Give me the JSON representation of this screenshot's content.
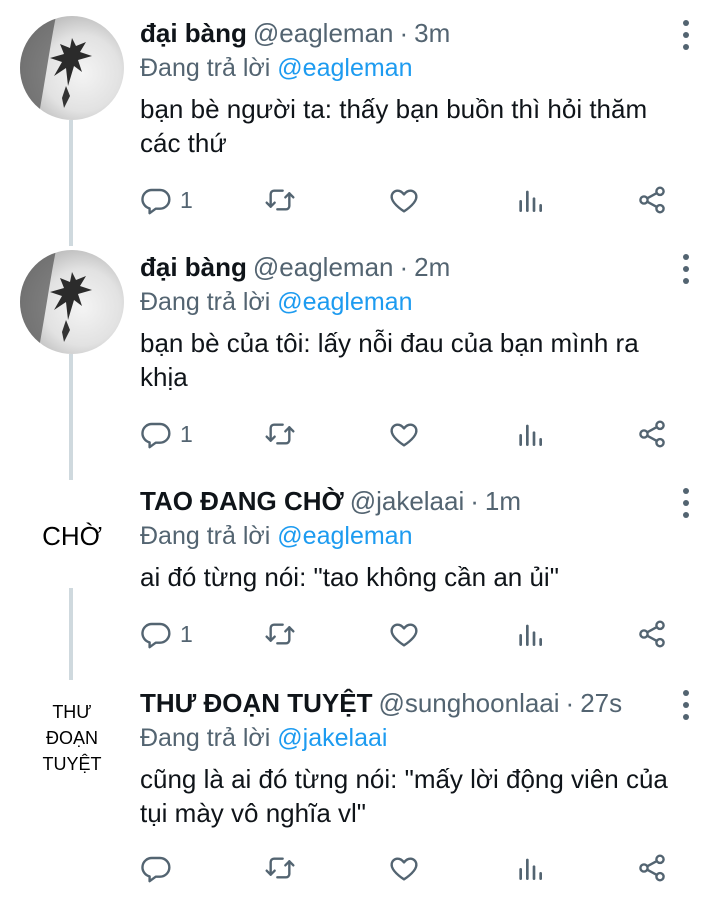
{
  "replying_to_label": "Đang trả lời",
  "tweets": [
    {
      "name": "đại bàng",
      "handle": "@eagleman",
      "time": "3m",
      "reply_to": "@eagleman",
      "text": "bạn bè người ta: thấy bạn buồn thì hỏi thăm các thứ",
      "reply_count": "1",
      "avatar_icon": "eagle-photo-avatar"
    },
    {
      "name": "đại bàng",
      "handle": "@eagleman",
      "time": "2m",
      "reply_to": "@eagleman",
      "text": "bạn bè của tôi: lấy nỗi đau của bạn mình ra khịa",
      "reply_count": "1",
      "avatar_icon": "eagle-photo-avatar"
    },
    {
      "name": "TAO ĐANG CHỜ",
      "handle": "@jakelaai",
      "time": "1m",
      "reply_to": "@eagleman",
      "text": "ai đó từng nói: \"tao không cần an ủi\"",
      "reply_count": "1",
      "avatar_text": "CHỜ"
    },
    {
      "name": "THƯ ĐOẠN TUYỆT",
      "handle": "@sunghoonlaai",
      "time": "27s",
      "reply_to": "@jakelaai",
      "text": "cũng là ai đó từng nói: \"mấy lời động viên của tụi mày vô nghĩa vl\"",
      "reply_count": "",
      "avatar_text_lines": [
        "THƯ",
        "ĐOẠN",
        "TUYỆT"
      ]
    }
  ],
  "colors": {
    "link": "#1d9bf0",
    "secondary_text": "#536471",
    "primary_text": "#0f1419",
    "thread_line": "#cfd9de"
  },
  "action_icons": [
    "reply-icon",
    "retweet-icon",
    "like-icon",
    "analytics-icon",
    "share-icon"
  ]
}
